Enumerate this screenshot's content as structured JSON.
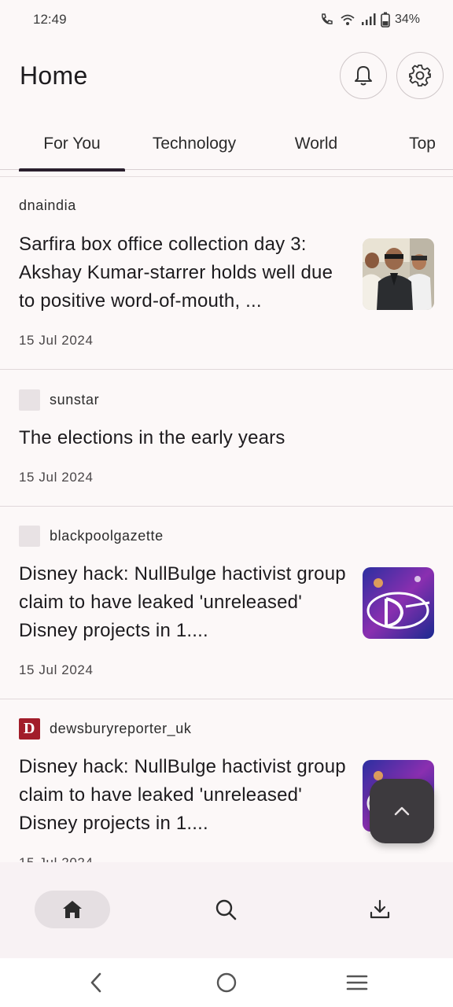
{
  "status_bar": {
    "time": "12:49",
    "battery": "34%"
  },
  "header": {
    "title": "Home"
  },
  "tabs": [
    {
      "label": "For You",
      "active": true
    },
    {
      "label": "Technology"
    },
    {
      "label": "World"
    },
    {
      "label": "Top"
    }
  ],
  "articles": [
    {
      "source": "dnaindia",
      "headline": "Sarfira box office collection day 3: Akshay Kumar-starrer holds well due to positive word-of-mouth, ...",
      "date": "15 Jul 2024"
    },
    {
      "source": "sunstar",
      "headline": "The elections in the early years",
      "date": "15 Jul 2024"
    },
    {
      "source": "blackpoolgazette",
      "headline": "Disney hack: NullBulge hactivist group claim to have leaked 'unreleased' Disney projects in 1....",
      "date": "15 Jul 2024"
    },
    {
      "source": "dewsburyreporter_uk",
      "source_logo_letter": "D",
      "headline": "Disney hack: NullBulge hactivist group claim to have leaked 'unreleased' Disney projects in 1....",
      "date": "15 Jul 2024"
    }
  ],
  "bottom_nav": [
    "home",
    "search",
    "downloads"
  ],
  "colors": {
    "background": "#fcf8f8",
    "tab_indicator": "#2a1f2d",
    "fab": "#3d3a3e",
    "dewsbury_logo": "#a21d2a"
  }
}
